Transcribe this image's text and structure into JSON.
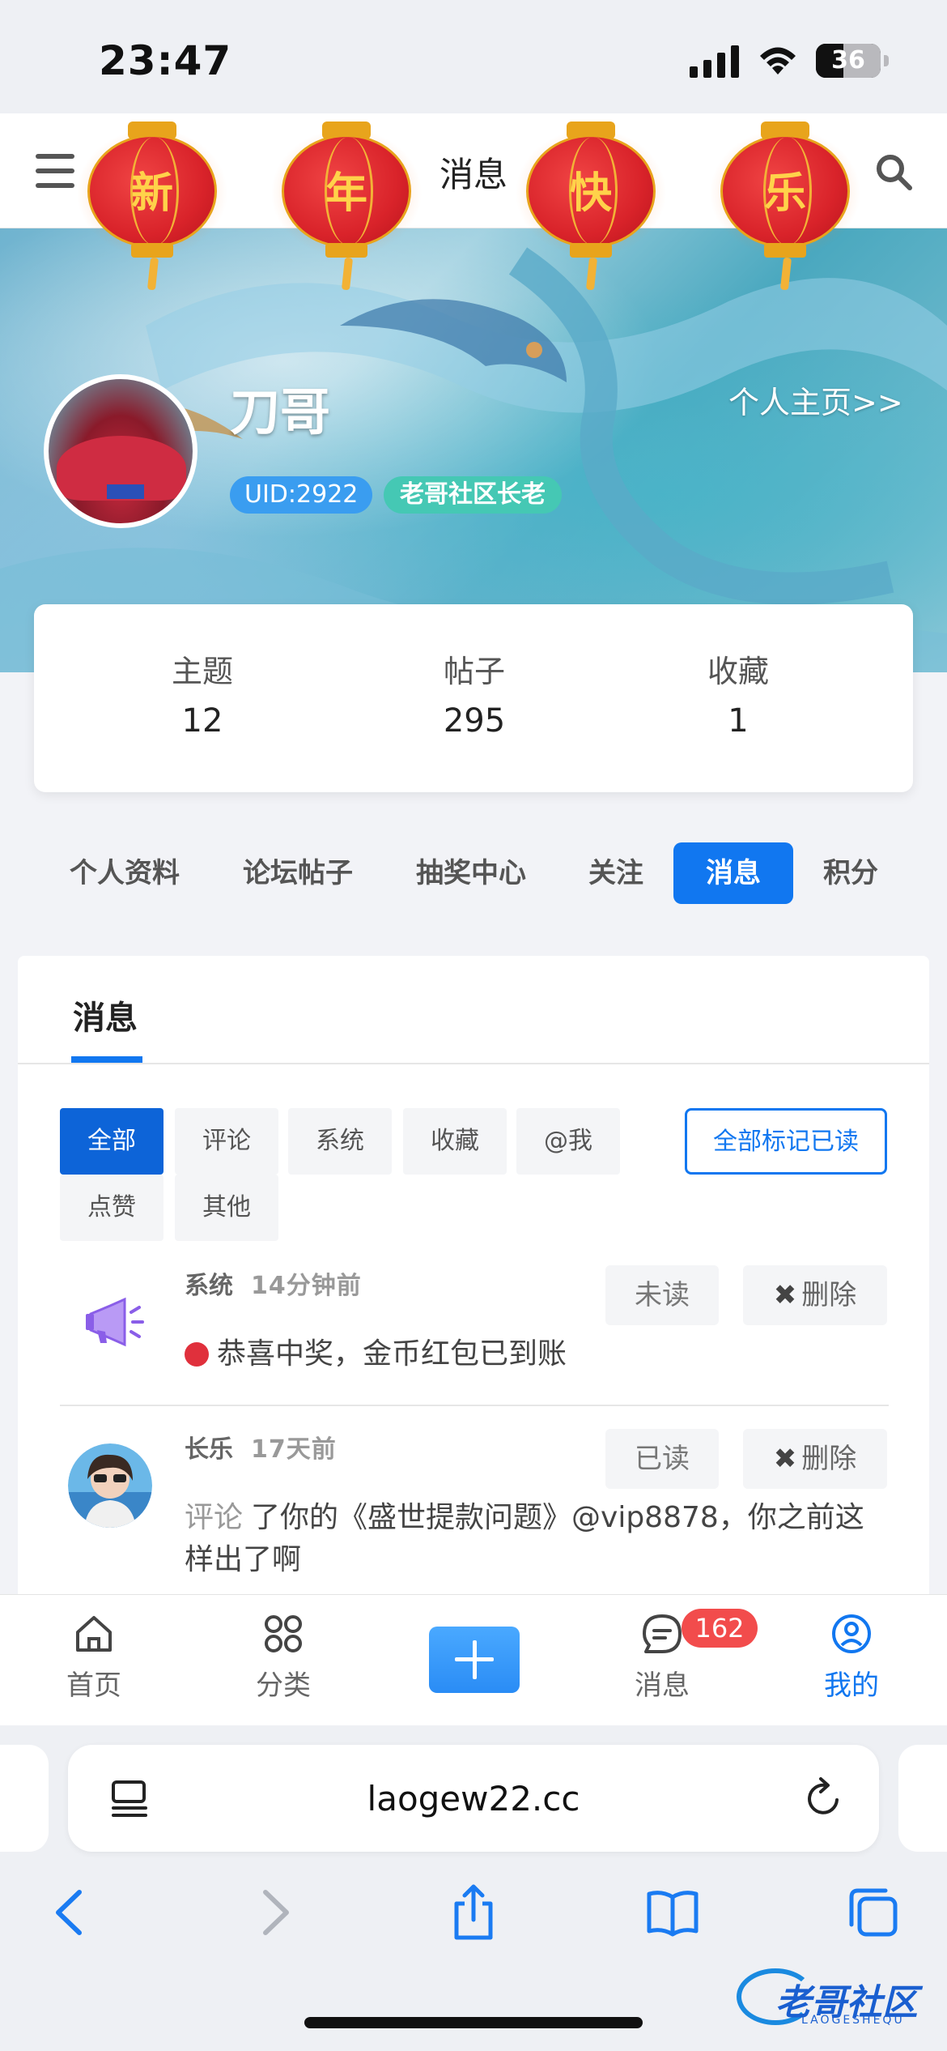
{
  "status_bar": {
    "time": "23:47",
    "battery": "36"
  },
  "top_nav": {
    "title": "消息"
  },
  "lanterns": [
    "新",
    "年",
    "快",
    "乐"
  ],
  "profile": {
    "username": "刀哥",
    "homepage_link": "个人主页>>",
    "uid": "UID:2922",
    "title_badge": "老哥社区长老"
  },
  "stats": [
    {
      "label": "主题",
      "value": "12"
    },
    {
      "label": "帖子",
      "value": "295"
    },
    {
      "label": "收藏",
      "value": "1"
    }
  ],
  "profile_tabs": [
    {
      "label": "个人资料",
      "active": false
    },
    {
      "label": "论坛帖子",
      "active": false
    },
    {
      "label": "抽奖中心",
      "active": false
    },
    {
      "label": "关注",
      "active": false
    },
    {
      "label": "消息",
      "active": true
    },
    {
      "label": "积分",
      "active": false
    }
  ],
  "messages_panel": {
    "tab_label": "消息",
    "filters": [
      "全部",
      "评论",
      "系统",
      "收藏",
      "@我",
      "点赞",
      "其他"
    ],
    "active_filter": "全部",
    "mark_all_read": "全部标记已读",
    "items": [
      {
        "sender": "系统",
        "time": "14分钟前",
        "status": "未读",
        "delete_label": "删除",
        "text": "恭喜中奖，金币红包已到账",
        "unread_dot": true,
        "icon": "megaphone-icon"
      },
      {
        "sender": "长乐",
        "time": "17天前",
        "status": "已读",
        "delete_label": "删除",
        "kind": "评论",
        "text_line1": "了你的《盛世提款问题》@vip8878，你之前这",
        "text_line2": "样出了啊",
        "icon": "user-avatar"
      }
    ]
  },
  "bottom_tabs": [
    {
      "label": "首页",
      "icon": "home-icon"
    },
    {
      "label": "分类",
      "icon": "grid-icon"
    },
    {
      "label": "消息",
      "icon": "chat-icon",
      "badge": "162"
    },
    {
      "label": "我的",
      "icon": "profile-icon",
      "active": true
    }
  ],
  "browser": {
    "url": "laogew22.cc"
  },
  "watermark": {
    "text": "老哥社区",
    "sub": "LAOGESHEQU"
  },
  "colors": {
    "accent": "#1177f0",
    "badge_red": "#f24c4c",
    "unread_dot": "#e0303c"
  }
}
